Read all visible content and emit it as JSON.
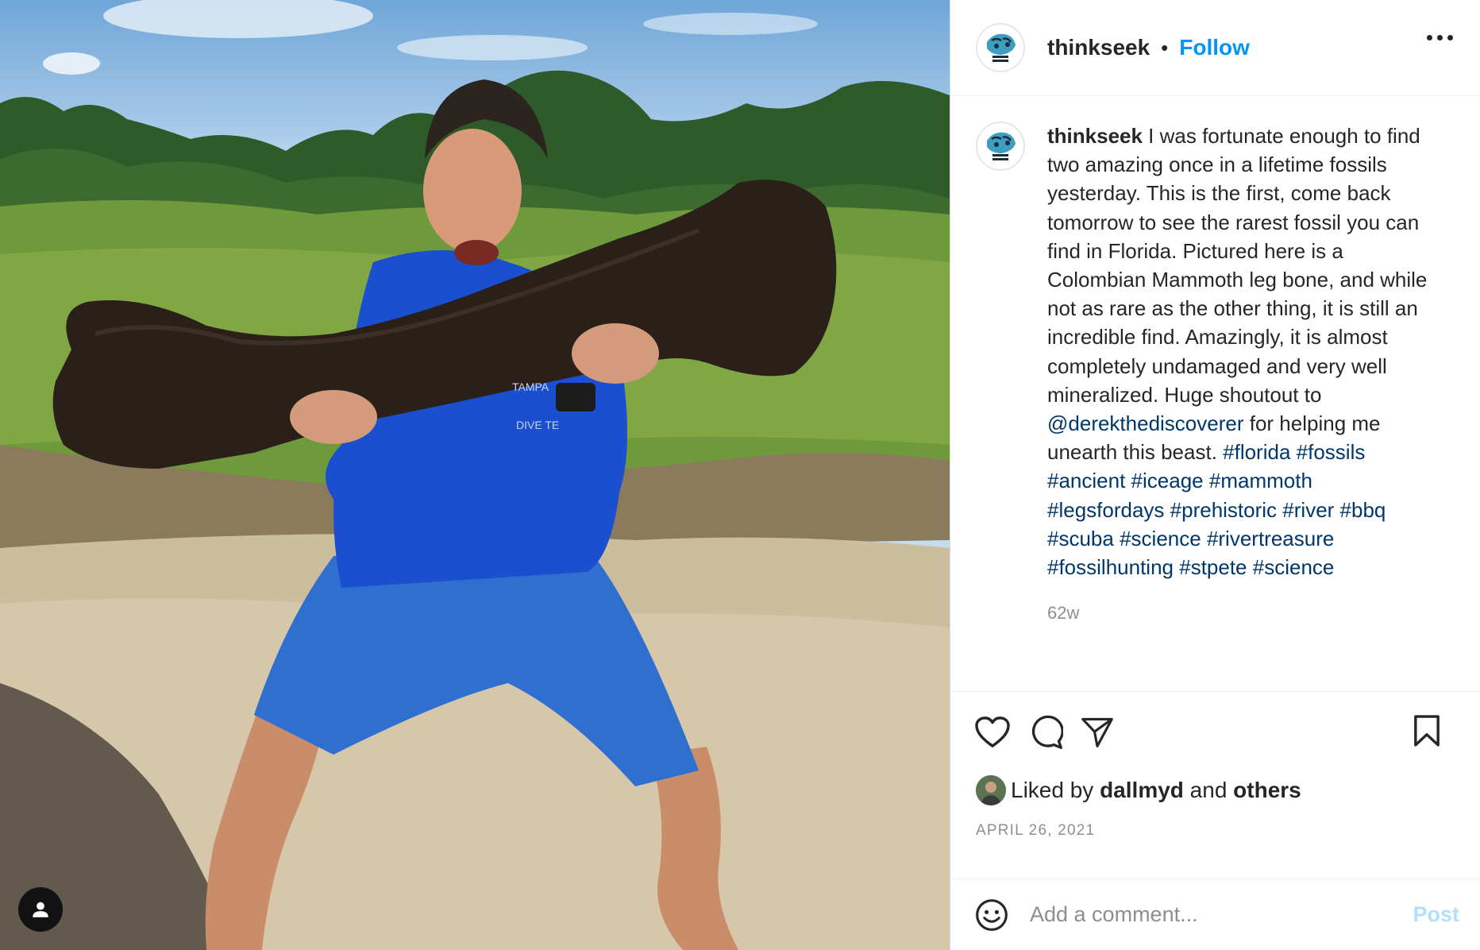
{
  "photo": {
    "description_icon": "user-tag-icon",
    "shirt_text_top": "TAMPA",
    "shirt_text_bottom": "DIVE TE"
  },
  "header": {
    "username": "thinkseek",
    "separator": "•",
    "follow_label": "Follow",
    "more_icon": "more-options-icon"
  },
  "caption": {
    "username": "thinkseek",
    "text_1": " I was fortunate enough to find two amazing once in a lifetime fossils yesterday. This is the first, come back tomorrow to see the rarest fossil you can find in Florida. Pictured here is a Colombian Mammoth leg bone, and while not as rare as the other thing, it is still an incredible find. Amazingly, it is almost completely undamaged and very well mineralized. Huge shoutout to ",
    "mention": "@derekthediscoverer",
    "text_2": " for helping me unearth this beast. ",
    "hashtags": [
      "#florida",
      "#fossils",
      "#ancient",
      "#iceage",
      "#mammoth",
      "#legsfordays",
      "#prehistoric",
      "#river",
      "#bbq",
      "#scuba",
      "#science",
      "#rivertreasure",
      "#fossilhunting",
      "#stpete",
      "#science"
    ],
    "time_ago": "62w"
  },
  "actions": {
    "like_icon": "heart-icon",
    "comment_icon": "comment-icon",
    "share_icon": "share-icon",
    "save_icon": "bookmark-icon"
  },
  "likes": {
    "prefix": "Liked by",
    "user": "dallmyd",
    "and": "and",
    "others": "others"
  },
  "date": "APRIL 26, 2021",
  "comment": {
    "placeholder": "Add a comment...",
    "post_label": "Post",
    "emoji_icon": "emoji-icon"
  },
  "colors": {
    "link_blue": "#0095f6",
    "hashtag_blue": "#00376b",
    "muted": "#8e8e8e",
    "post_disabled": "#b2dffc"
  }
}
